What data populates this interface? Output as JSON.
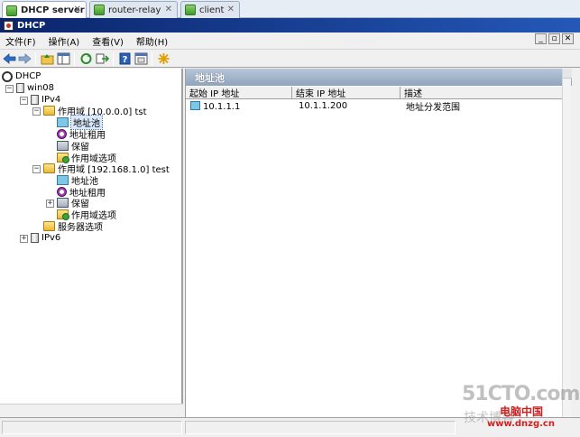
{
  "vm_tabs": [
    {
      "label": "DHCP server",
      "active": true
    },
    {
      "label": "router-relay",
      "active": false
    },
    {
      "label": "client",
      "active": false
    }
  ],
  "window": {
    "title": "DHCP",
    "controls": {
      "minimize": "_",
      "restore": "▫",
      "close": "✕"
    }
  },
  "menu": [
    {
      "label": "文件(F)"
    },
    {
      "label": "操作(A)"
    },
    {
      "label": "查看(V)"
    },
    {
      "label": "帮助(H)"
    }
  ],
  "toolbar": {
    "icons": [
      "back-icon",
      "forward-icon",
      "up-folder-icon",
      "show-hide-tree-icon",
      "refresh-icon",
      "export-list-icon",
      "help-icon",
      "properties-icon",
      "new-scope-icon"
    ]
  },
  "tree": {
    "root": "DHCP",
    "server": "win08",
    "ipv4": "IPv4",
    "scope1": {
      "label": "作用域 [10.0.0.0] tst",
      "pool": "地址池",
      "leases": "地址租用",
      "reservations": "保留",
      "options": "作用域选项"
    },
    "scope2": {
      "label": "作用域 [192.168.1.0] test",
      "pool": "地址池",
      "leases": "地址租用",
      "reservations": "保留",
      "options": "作用域选项"
    },
    "server_options": "服务器选项",
    "ipv6": "IPv6",
    "expanders": {
      "minus": "−",
      "plus": "+"
    }
  },
  "pane": {
    "title": "地址池",
    "columns": [
      "起始 IP 地址",
      "结束 IP 地址",
      "描述"
    ],
    "rows": [
      {
        "start": "10.1.1.1",
        "end": "10.1.1.200",
        "desc": "地址分发范围"
      }
    ]
  },
  "watermark": {
    "logo": "51CTO.com",
    "sub": "技术博客",
    "site": "电脑中国",
    "url": "www.dnzg.cn"
  },
  "colors": {
    "titlebar": "#0a246a",
    "pane_header": "#8fa5bd",
    "selection": "#d9e8fb"
  }
}
